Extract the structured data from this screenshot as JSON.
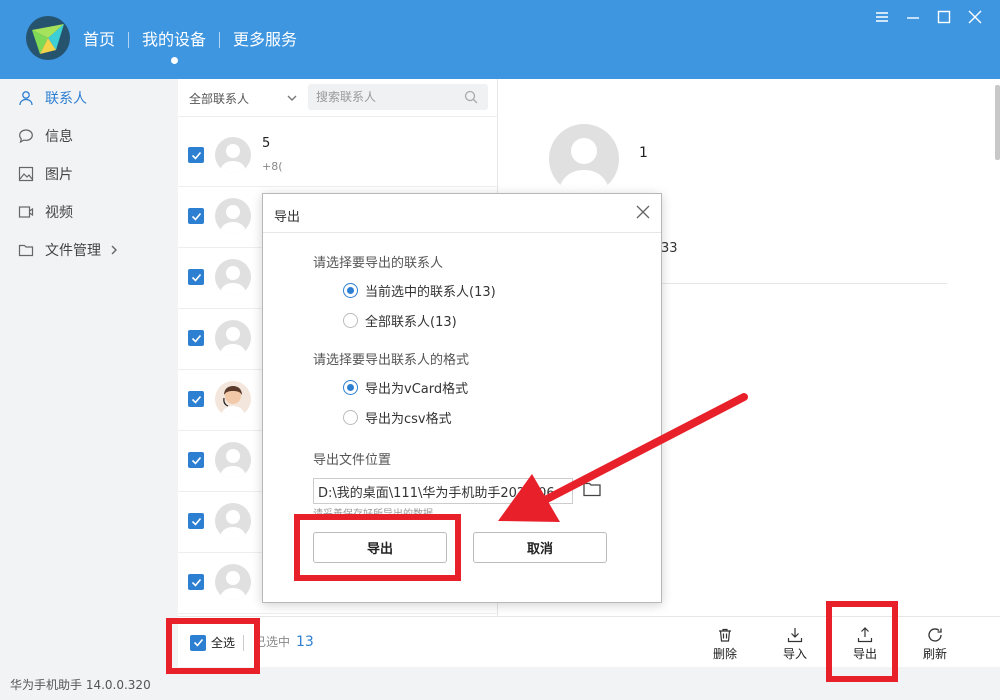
{
  "app": {
    "nav": [
      "首页",
      "我的设备",
      "更多服务"
    ],
    "active_nav_index": 1,
    "status_text": "华为手机助手 14.0.0.320"
  },
  "sidebar": {
    "items": [
      {
        "label": "联系人",
        "icon": "person-icon",
        "active": true
      },
      {
        "label": "信息",
        "icon": "message-icon",
        "active": false
      },
      {
        "label": "图片",
        "icon": "image-icon",
        "active": false
      },
      {
        "label": "视频",
        "icon": "video-icon",
        "active": false
      },
      {
        "label": "文件管理",
        "icon": "folder-icon",
        "active": false
      }
    ]
  },
  "list": {
    "filter": "全部联系人",
    "search_placeholder": "搜索联系人",
    "first_row": {
      "name": "5",
      "phone": "+8("
    },
    "row_count": 8
  },
  "detail": {
    "name": "1",
    "phone_fragment": "33"
  },
  "bottom": {
    "select_all": "全选",
    "selected_label": "已选中",
    "selected_count": "13",
    "tools": [
      "删除",
      "导入",
      "导出",
      "刷新"
    ]
  },
  "dialog": {
    "title": "导出",
    "section1": "请选择要导出的联系人",
    "option_selected": "当前选中的联系人(13)",
    "option_all": "全部联系人(13)",
    "section2": "请选择要导出联系人的格式",
    "format_vcard": "导出为vCard格式",
    "format_csv": "导出为csv格式",
    "location_label": "导出文件位置",
    "path": "D:\\我的桌面\\111\\华为手机助手2024-06",
    "hint": "请妥善保存好所导出的数据",
    "export_btn": "导出",
    "cancel_btn": "取消"
  },
  "colors": {
    "header": "#3f96e0",
    "accent": "#2d7fd2",
    "annotation": "#e8202a"
  }
}
